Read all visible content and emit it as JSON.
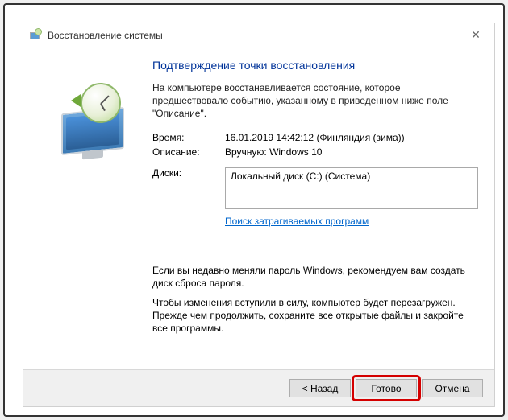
{
  "window": {
    "title": "Восстановление системы"
  },
  "main": {
    "heading": "Подтверждение точки восстановления",
    "description": "На компьютере восстанавливается состояние, которое предшествовало событию, указанному в приведенном ниже поле \"Описание\".",
    "time_label": "Время:",
    "time_value": "16.01.2019 14:42:12 (Финляндия (зима))",
    "desc_label": "Описание:",
    "desc_value": "Вручную: Windows 10",
    "disks_label": "Диски:",
    "disks_value": "Локальный диск (C:) (Система)",
    "scan_link": "Поиск затрагиваемых программ",
    "note1": "Если вы недавно меняли пароль Windows, рекомендуем вам создать диск сброса пароля.",
    "note2": "Чтобы изменения вступили в силу, компьютер будет перезагружен. Прежде чем продолжить, сохраните все открытые файлы и закройте все программы."
  },
  "footer": {
    "back": "< Назад",
    "finish": "Готово",
    "cancel": "Отмена"
  }
}
